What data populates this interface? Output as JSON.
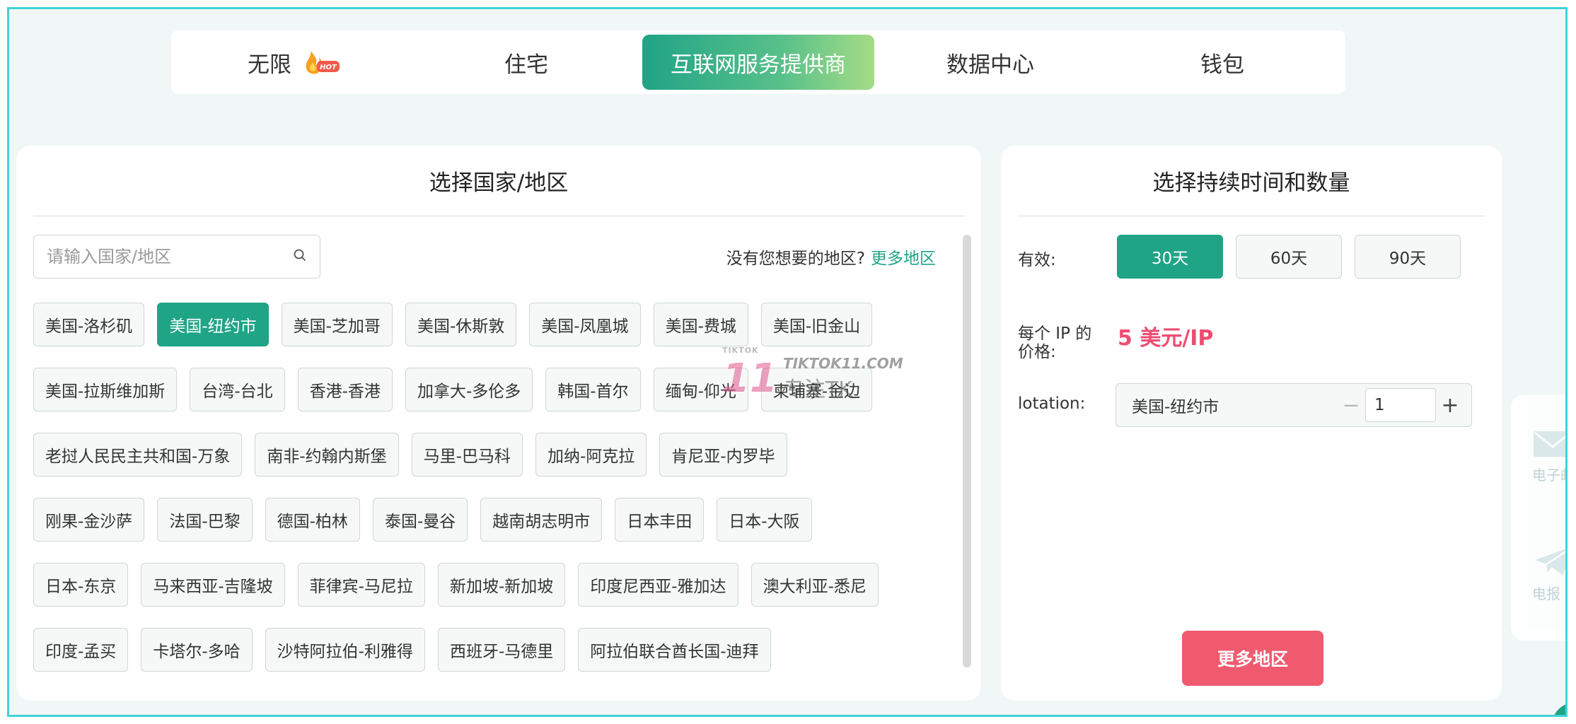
{
  "tabs": [
    {
      "label": "无限",
      "badge": "HOT",
      "active": false
    },
    {
      "label": "住宅",
      "active": false
    },
    {
      "label": "互联网服务提供商",
      "active": true
    },
    {
      "label": "数据中心",
      "active": false
    },
    {
      "label": "钱包",
      "active": false
    }
  ],
  "left_panel": {
    "title": "选择国家/地区",
    "search_placeholder": "请输入国家/地区",
    "hint": "没有您想要的地区?",
    "hint_link": "更多地区",
    "regions": [
      [
        "美国-洛杉矶",
        "美国-纽约市",
        "美国-芝加哥",
        "美国-休斯敦",
        "美国-凤凰城",
        "美国-费城",
        "美国-旧金山"
      ],
      [
        "美国-拉斯维加斯",
        "台湾-台北",
        "香港-香港",
        "加拿大-多伦多",
        "韩国-首尔",
        "缅甸-仰光",
        "柬埔寨-金边"
      ],
      [
        "老挝人民民主共和国-万象",
        "南非-约翰内斯堡",
        "马里-巴马科",
        "加纳-阿克拉",
        "肯尼亚-内罗毕"
      ],
      [
        "刚果-金沙萨",
        "法国-巴黎",
        "德国-柏林",
        "泰国-曼谷",
        "越南胡志明市",
        "日本丰田",
        "日本-大阪"
      ],
      [
        "日本-东京",
        "马来西亚-吉隆坡",
        "菲律宾-马尼拉",
        "新加坡-新加坡",
        "印度尼西亚-雅加达",
        "澳大利亚-悉尼"
      ],
      [
        "印度-孟买",
        "卡塔尔-多哈",
        "沙特阿拉伯-利雅得",
        "西班牙-马德里",
        "阿拉伯联合酋长国-迪拜"
      ]
    ],
    "selected_region": "美国-纽约市"
  },
  "right_panel": {
    "title": "选择持续时间和数量",
    "validity_label": "有效:",
    "durations": [
      {
        "label": "30天",
        "active": true
      },
      {
        "label": "60天",
        "active": false
      },
      {
        "label": "90天",
        "active": false
      }
    ],
    "price_label": "每个 IP 的价格:",
    "price_value": "5 美元/IP",
    "location_label": "lotation:",
    "location_value": "美国-纽约市",
    "quantity": "1",
    "cta": "更多地区"
  },
  "side_widget": {
    "email_label": "电子邮",
    "telegram_label": "电报"
  },
  "watermark": {
    "small": "TIKTOK",
    "number": "11",
    "domain": "TIKTOK11.COM",
    "cn": "专注TK"
  },
  "colors": {
    "accent": "#20a486",
    "price": "#ee4d72",
    "cta": "#ef5a6f",
    "frame": "#40d2d8"
  }
}
